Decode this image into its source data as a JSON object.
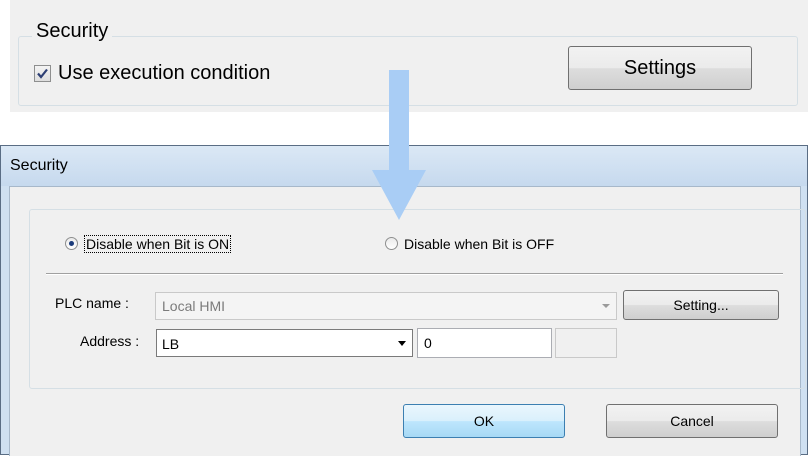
{
  "top_panel": {
    "group_title": "Security",
    "checkbox_label": "Use execution condition",
    "checkbox_checked": true,
    "settings_button": "Settings"
  },
  "arrow": {
    "color": "#a9cdf5",
    "icon": "arrow-down-icon"
  },
  "dialog": {
    "title": "Security",
    "radio_on_label": "Disable when Bit is ON",
    "radio_off_label": "Disable when Bit is OFF",
    "selected_radio": "on",
    "plc_name_label": "PLC name :",
    "plc_name_value": "Local HMI",
    "setting_button": "Setting...",
    "address_label": "Address :",
    "address_device": "LB",
    "address_value": "0",
    "ok_button": "OK",
    "cancel_button": "Cancel"
  }
}
